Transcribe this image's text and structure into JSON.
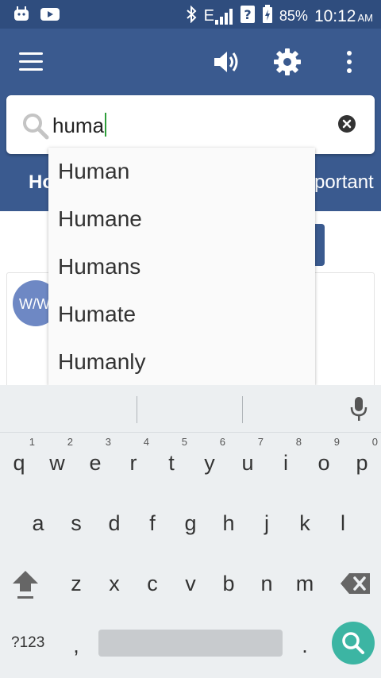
{
  "status_bar": {
    "network": "E",
    "battery_percent": "85%",
    "time": "10:12",
    "ampm": "AM"
  },
  "search": {
    "query": "huma"
  },
  "tabs": {
    "left_partial": "Ho",
    "right_partial": "portant"
  },
  "avatar_text": "W/W",
  "suggestions": [
    "Human",
    "Humane",
    "Humans",
    "Humate",
    "Humanly"
  ],
  "keyboard": {
    "row1": [
      {
        "k": "q",
        "n": "1"
      },
      {
        "k": "w",
        "n": "2"
      },
      {
        "k": "e",
        "n": "3"
      },
      {
        "k": "r",
        "n": "4"
      },
      {
        "k": "t",
        "n": "5"
      },
      {
        "k": "y",
        "n": "6"
      },
      {
        "k": "u",
        "n": "7"
      },
      {
        "k": "i",
        "n": "8"
      },
      {
        "k": "o",
        "n": "9"
      },
      {
        "k": "p",
        "n": "0"
      }
    ],
    "row2": [
      "a",
      "s",
      "d",
      "f",
      "g",
      "h",
      "j",
      "k",
      "l"
    ],
    "row3": [
      "z",
      "x",
      "c",
      "v",
      "b",
      "n",
      "m"
    ],
    "symbols_label": "?123",
    "comma": ",",
    "period": "."
  },
  "colors": {
    "status_bar": "#2f4d7e",
    "app_bar": "#3a5a8f",
    "caret": "#2e9e3a",
    "search_key": "#3cb5a3"
  }
}
